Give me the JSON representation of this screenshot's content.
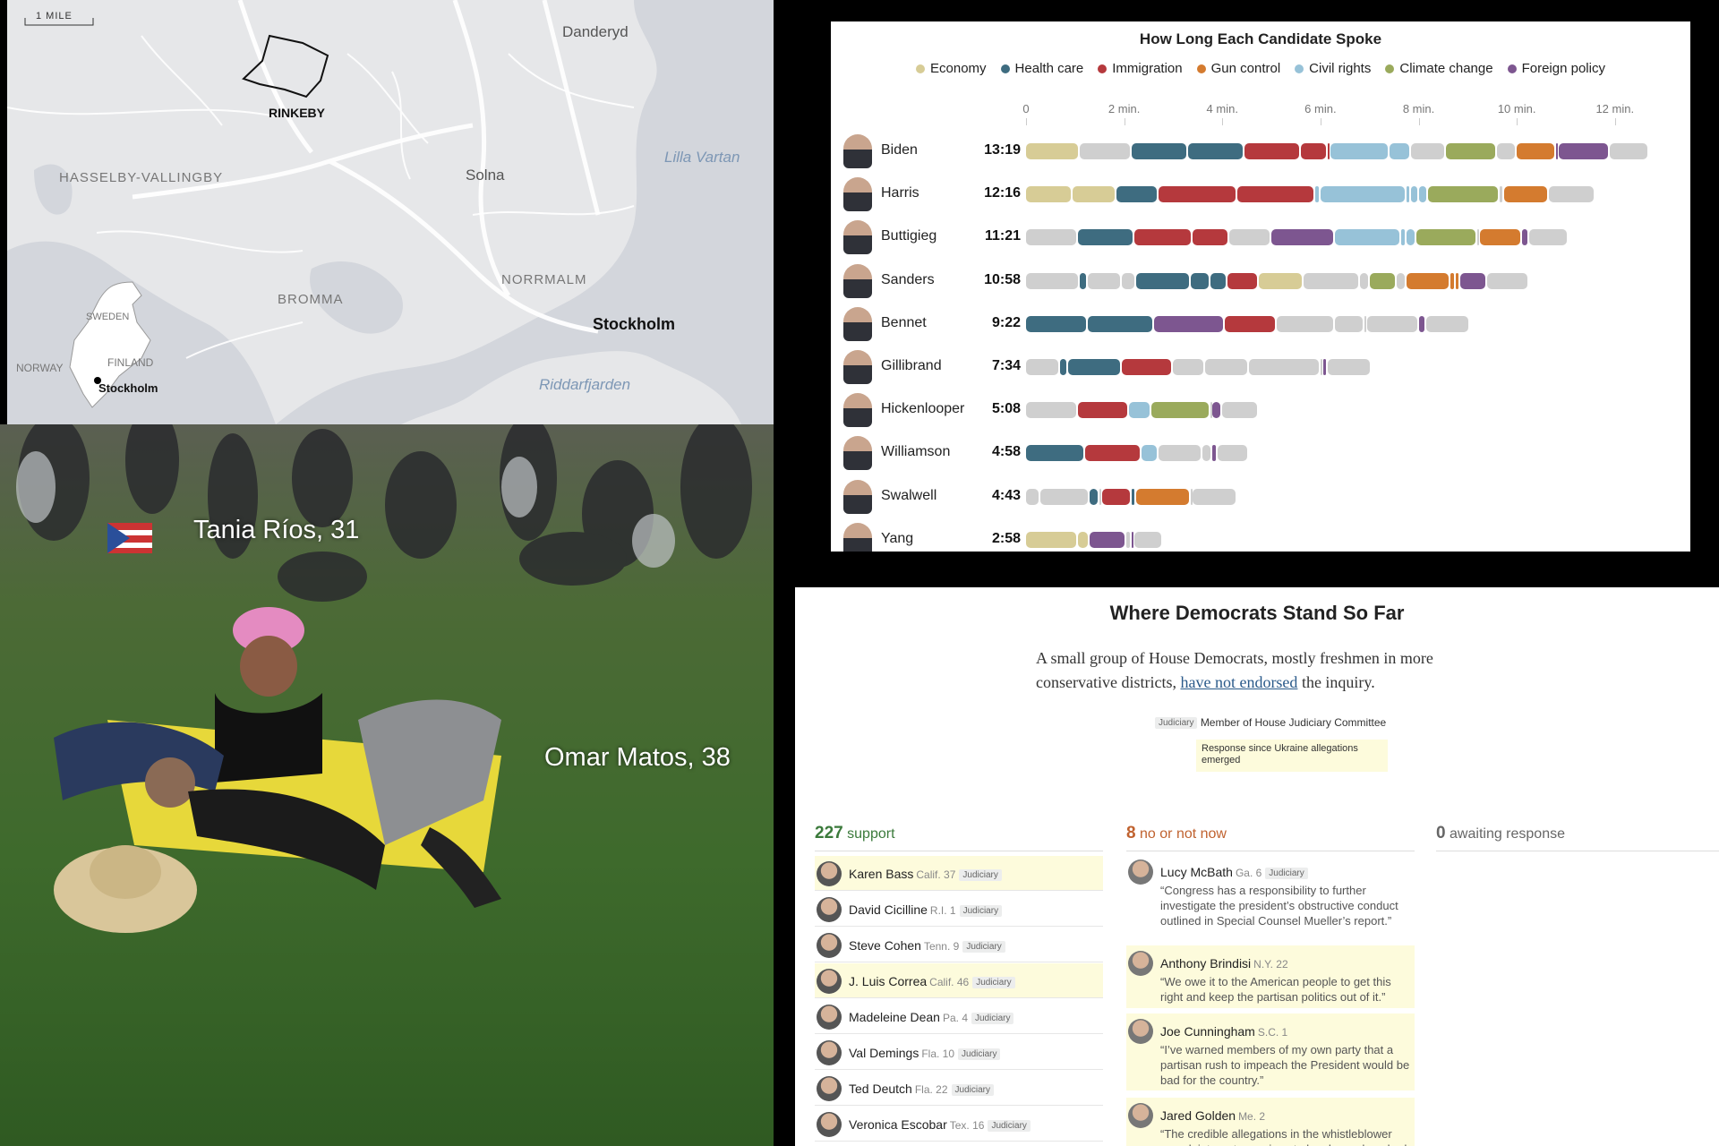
{
  "map": {
    "scale": "1 MILE",
    "labels": {
      "danderyd": "Danderyd",
      "rinkeby": "RINKEBY",
      "hasselby": "HASSELBY-VALLINGBY",
      "solna": "Solna",
      "lilla_vartan": "Lilla Vartan",
      "norrmalm": "NORRMALM",
      "bromma": "BROMMA",
      "stockholm": "Stockholm",
      "riddarfjarden": "Riddarfjarden",
      "sweden": "SWEDEN",
      "finland": "FINLAND",
      "norway": "NORWAY",
      "inset_stockholm": "Stockholm"
    }
  },
  "photo": {
    "name1": "Tania Ríos, 31",
    "name2": "Omar Matos, 38"
  },
  "chart_data": {
    "type": "bar",
    "title": "How Long Each Candidate Spoke",
    "legend": [
      {
        "name": "Economy",
        "color": "#d7cc96"
      },
      {
        "name": "Health care",
        "color": "#3e6c80"
      },
      {
        "name": "Immigration",
        "color": "#b5393d"
      },
      {
        "name": "Gun control",
        "color": "#d47b2f"
      },
      {
        "name": "Civil rights",
        "color": "#97c2d8"
      },
      {
        "name": "Climate change",
        "color": "#9aaa5c"
      },
      {
        "name": "Foreign policy",
        "color": "#7d5690"
      }
    ],
    "other_color": "#cfcfcf",
    "x_ticks": [
      {
        "value": 0,
        "label": "0"
      },
      {
        "value": 2,
        "label": "2 min."
      },
      {
        "value": 4,
        "label": "4 min."
      },
      {
        "value": 6,
        "label": "6 min."
      },
      {
        "value": 8,
        "label": "8 min."
      },
      {
        "value": 10,
        "label": "10 min."
      },
      {
        "value": 12,
        "label": "12 min."
      }
    ],
    "xlim": [
      0,
      13.5
    ],
    "candidates": [
      {
        "name": "Biden",
        "time": "13:19",
        "segments": [
          [
            "Economy",
            1.1
          ],
          [
            "Other",
            1.05
          ],
          [
            "Health care",
            1.15
          ],
          [
            "Health care",
            1.15
          ],
          [
            "Immigration",
            1.15
          ],
          [
            "Immigration",
            0.55
          ],
          [
            "Immigration",
            0.05
          ],
          [
            "Civil rights",
            1.2
          ],
          [
            "Civil rights",
            0.45
          ],
          [
            "Other",
            0.7
          ],
          [
            "Climate change",
            1.05
          ],
          [
            "Other",
            0.4
          ],
          [
            "Gun control",
            0.8
          ],
          [
            "Foreign policy",
            0.05
          ],
          [
            "Foreign policy",
            1.05
          ],
          [
            "Other",
            0.8
          ]
        ]
      },
      {
        "name": "Harris",
        "time": "12:16",
        "segments": [
          [
            "Economy",
            0.95
          ],
          [
            "Economy",
            0.9
          ],
          [
            "Health care",
            0.85
          ],
          [
            "Immigration",
            1.6
          ],
          [
            "Immigration",
            1.6
          ],
          [
            "Civil rights",
            0.1
          ],
          [
            "Civil rights",
            1.75
          ],
          [
            "Civil rights",
            0.1
          ],
          [
            "Civil rights",
            0.15
          ],
          [
            "Civil rights",
            0.2
          ],
          [
            "Climate change",
            1.45
          ],
          [
            "Other",
            0.1
          ],
          [
            "Gun control",
            0.9
          ],
          [
            "Other",
            0.95
          ]
        ]
      },
      {
        "name": "Buttigieg",
        "time": "11:21",
        "segments": [
          [
            "Other",
            1.05
          ],
          [
            "Health care",
            1.15
          ],
          [
            "Immigration",
            1.2
          ],
          [
            "Immigration",
            0.75
          ],
          [
            "Other",
            0.85
          ],
          [
            "Foreign policy",
            1.3
          ],
          [
            "Civil rights",
            1.35
          ],
          [
            "Civil rights",
            0.1
          ],
          [
            "Civil rights",
            0.2
          ],
          [
            "Climate change",
            1.25
          ],
          [
            "Other",
            0.05
          ],
          [
            "Gun control",
            0.85
          ],
          [
            "Foreign policy",
            0.15
          ],
          [
            "Other",
            0.8
          ]
        ]
      },
      {
        "name": "Sanders",
        "time": "10:58",
        "segments": [
          [
            "Other",
            1.1
          ],
          [
            "Health care",
            0.15
          ],
          [
            "Other",
            0.7
          ],
          [
            "Other",
            0.3
          ],
          [
            "Health care",
            1.1
          ],
          [
            "Health care",
            0.4
          ],
          [
            "Health care",
            0.35
          ],
          [
            "Immigration",
            0.65
          ],
          [
            "Economy",
            0.9
          ],
          [
            "Other",
            1.15
          ],
          [
            "Other",
            0.2
          ],
          [
            "Climate change",
            0.55
          ],
          [
            "Other",
            0.2
          ],
          [
            "Gun control",
            0.9
          ],
          [
            "Gun control",
            0.1
          ],
          [
            "Gun control",
            0.1
          ],
          [
            "Foreign policy",
            0.55
          ],
          [
            "Other",
            0.85
          ]
        ]
      },
      {
        "name": "Bennet",
        "time": "9:22",
        "segments": [
          [
            "Health care",
            1.25
          ],
          [
            "Health care",
            1.35
          ],
          [
            "Foreign policy",
            1.45
          ],
          [
            "Immigration",
            1.05
          ],
          [
            "Other",
            1.2
          ],
          [
            "Other",
            0.6
          ],
          [
            "Other",
            0.05
          ],
          [
            "Other",
            1.05
          ],
          [
            "Foreign policy",
            0.15
          ],
          [
            "Other",
            0.9
          ]
        ]
      },
      {
        "name": "Gillibrand",
        "time": "7:34",
        "segments": [
          [
            "Other",
            0.7
          ],
          [
            "Health care",
            0.15
          ],
          [
            "Health care",
            1.1
          ],
          [
            "Immigration",
            1.05
          ],
          [
            "Other",
            0.65
          ],
          [
            "Other",
            0.9
          ],
          [
            "Other",
            1.45
          ],
          [
            "Other",
            0.05
          ],
          [
            "Foreign policy",
            0.1
          ],
          [
            "Other",
            0.9
          ]
        ]
      },
      {
        "name": "Hickenlooper",
        "time": "5:08",
        "segments": [
          [
            "Other",
            1.05
          ],
          [
            "Immigration",
            1.05
          ],
          [
            "Civil rights",
            0.45
          ],
          [
            "Climate change",
            1.2
          ],
          [
            "Other",
            0.05
          ],
          [
            "Foreign policy",
            0.2
          ],
          [
            "Other",
            0.75
          ]
        ]
      },
      {
        "name": "Williamson",
        "time": "4:58",
        "segments": [
          [
            "Health care",
            1.2
          ],
          [
            "Immigration",
            1.15
          ],
          [
            "Civil rights",
            0.35
          ],
          [
            "Other",
            0.9
          ],
          [
            "Other",
            0.2
          ],
          [
            "Foreign policy",
            0.1
          ],
          [
            "Other",
            0.65
          ]
        ]
      },
      {
        "name": "Swalwell",
        "time": "4:43",
        "segments": [
          [
            "Other",
            0.3
          ],
          [
            "Other",
            1.0
          ],
          [
            "Health care",
            0.2
          ],
          [
            "Other",
            0.05
          ],
          [
            "Immigration",
            0.6
          ],
          [
            "Health care",
            0.1
          ],
          [
            "Gun control",
            1.1
          ],
          [
            "Other",
            0.05
          ],
          [
            "Other",
            0.9
          ]
        ]
      },
      {
        "name": "Yang",
        "time": "2:58",
        "segments": [
          [
            "Economy",
            1.05
          ],
          [
            "Economy",
            0.25
          ],
          [
            "Foreign policy",
            0.75
          ],
          [
            "Other",
            0.1
          ],
          [
            "Foreign policy",
            0.05
          ],
          [
            "Other",
            0.6
          ]
        ]
      }
    ]
  },
  "dems": {
    "title": "Where Democrats Stand So Far",
    "intro_before": "A small group of House Democrats, mostly freshmen in more conservative districts, ",
    "intro_link": "have not endorsed",
    "intro_after": " the inquiry.",
    "key_badge": "Judiciary",
    "key_label": "Member of House Judiciary Committee",
    "key_highlight": "Response since Ukraine allegations emerged",
    "support_count": "227",
    "support_label": "support",
    "no_count": "8",
    "no_label": "no or not now",
    "awaiting_count": "0",
    "awaiting_label": "awaiting response",
    "support_list": [
      {
        "name": "Karen Bass",
        "state": "Calif. 37",
        "badge": "Judiciary",
        "highlight": true
      },
      {
        "name": "David Cicilline",
        "state": "R.I. 1",
        "badge": "Judiciary",
        "highlight": false
      },
      {
        "name": "Steve Cohen",
        "state": "Tenn. 9",
        "badge": "Judiciary",
        "highlight": false
      },
      {
        "name": "J. Luis Correa",
        "state": "Calif. 46",
        "badge": "Judiciary",
        "highlight": true
      },
      {
        "name": "Madeleine Dean",
        "state": "Pa. 4",
        "badge": "Judiciary",
        "highlight": false
      },
      {
        "name": "Val Demings",
        "state": "Fla. 10",
        "badge": "Judiciary",
        "highlight": false
      },
      {
        "name": "Ted Deutch",
        "state": "Fla. 22",
        "badge": "Judiciary",
        "highlight": false
      },
      {
        "name": "Veronica Escobar",
        "state": "Tex. 16",
        "badge": "Judiciary",
        "highlight": false
      }
    ],
    "no_list": [
      {
        "name": "Lucy McBath",
        "state": "Ga. 6",
        "badge": "Judiciary",
        "quote": "“Congress has a responsibility to further investigate the president’s obstructive conduct outlined in Special Counsel Mueller’s report.”",
        "highlight": false
      },
      {
        "name": "Anthony Brindisi",
        "state": "N.Y. 22",
        "badge": "",
        "quote": "“We owe it to the American people to get this right and keep the partisan politics out of it.”",
        "highlight": true
      },
      {
        "name": "Joe Cunningham",
        "state": "S.C. 1",
        "badge": "",
        "quote": "“I’ve warned members of my own party that a partisan rush to impeach the President would be bad for the country.”",
        "highlight": true
      },
      {
        "name": "Jared Golden",
        "state": "Me. 2",
        "badge": "",
        "quote": "“The credible allegations in the whistleblower complaint are too serious to be cheered, rushed,",
        "highlight": true
      }
    ]
  }
}
